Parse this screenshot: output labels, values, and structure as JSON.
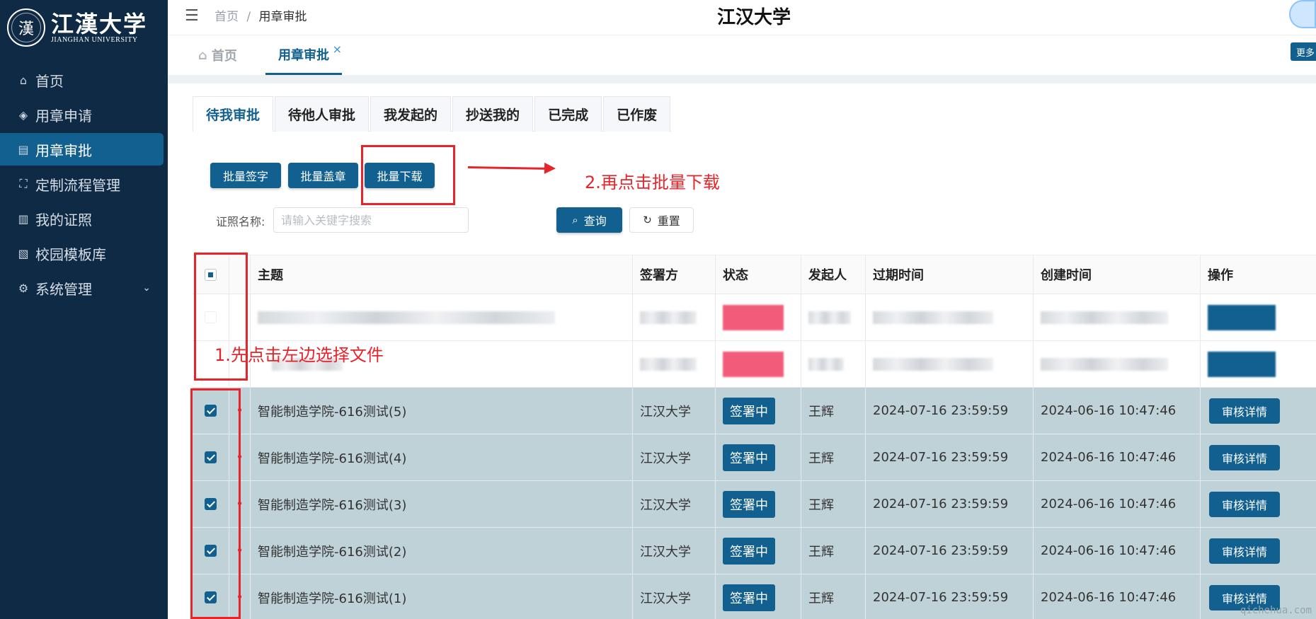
{
  "sidebar": {
    "logo_cn": "江漢大学",
    "logo_en": "JIANGHAN UNIVERSITY",
    "items": [
      {
        "label": "首页",
        "icon": "home-icon"
      },
      {
        "label": "用章申请",
        "icon": "target-icon"
      },
      {
        "label": "用章审批",
        "icon": "document-edit-icon",
        "active": true
      },
      {
        "label": "定制流程管理",
        "icon": "flow-icon"
      },
      {
        "label": "我的证照",
        "icon": "certificate-icon"
      },
      {
        "label": "校园模板库",
        "icon": "template-icon"
      },
      {
        "label": "系统管理",
        "icon": "gear-icon",
        "expandable": true
      }
    ]
  },
  "header": {
    "breadcrumb_root": "首页",
    "breadcrumb_sep": "/",
    "breadcrumb_current": "用章审批",
    "title": "江汉大学",
    "more_label": "更多"
  },
  "tags": {
    "home": "首页",
    "current": "用章审批",
    "close": "×"
  },
  "subtabs": [
    "待我审批",
    "待他人审批",
    "我发起的",
    "抄送我的",
    "已完成",
    "已作废"
  ],
  "toolbar": {
    "batch_sign": "批量签字",
    "batch_stamp": "批量盖章",
    "batch_download": "批量下载",
    "search_label": "证照名称:",
    "search_placeholder": "请输入关键字搜索",
    "query": "查询",
    "reset": "重置"
  },
  "annotations": {
    "step1": "1.先点击左边选择文件",
    "step2": "2.再点击批量下载"
  },
  "table": {
    "headers": [
      "主题",
      "签署方",
      "状态",
      "发起人",
      "过期时间",
      "创建时间",
      "操作"
    ],
    "rows": [
      {
        "subject": "智能制造学院-616测试(5)",
        "party": "江汉大学",
        "status": "签署中",
        "initiator": "王辉",
        "expire": "2024-07-16 23:59:59",
        "created": "2024-06-16 10:47:46",
        "action": "审核详情"
      },
      {
        "subject": "智能制造学院-616测试(4)",
        "party": "江汉大学",
        "status": "签署中",
        "initiator": "王辉",
        "expire": "2024-07-16 23:59:59",
        "created": "2024-06-16 10:47:46",
        "action": "审核详情"
      },
      {
        "subject": "智能制造学院-616测试(3)",
        "party": "江汉大学",
        "status": "签署中",
        "initiator": "王辉",
        "expire": "2024-07-16 23:59:59",
        "created": "2024-06-16 10:47:46",
        "action": "审核详情"
      },
      {
        "subject": "智能制造学院-616测试(2)",
        "party": "江汉大学",
        "status": "签署中",
        "initiator": "王辉",
        "expire": "2024-07-16 23:59:59",
        "created": "2024-06-16 10:47:46",
        "action": "审核详情"
      },
      {
        "subject": "智能制造学院-616测试(1)",
        "party": "江汉大学",
        "status": "签署中",
        "initiator": "王辉",
        "expire": "2024-07-16 23:59:59",
        "created": "2024-06-16 10:47:46",
        "action": "审核详情"
      }
    ]
  },
  "watermark": "qichehua.com",
  "colors": {
    "primary": "#11608f",
    "sidebar": "#0f2a45",
    "annotation": "#e8242b",
    "selected_row": "#bfd2d8"
  }
}
